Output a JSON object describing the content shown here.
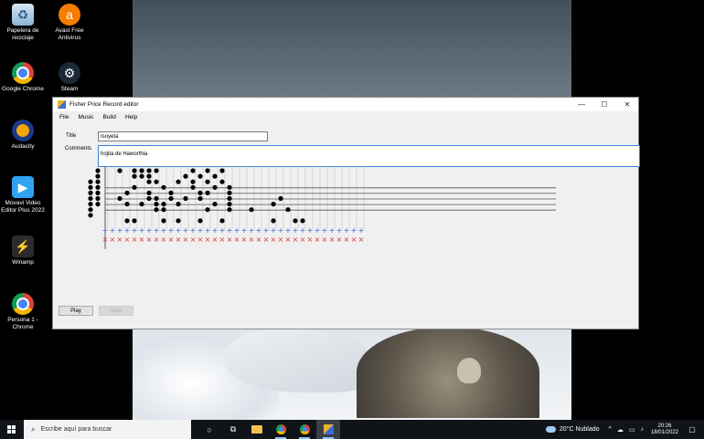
{
  "desktop": {
    "icons": [
      {
        "label": "Papelera de reciclaje",
        "glyph": "♻"
      },
      {
        "label": "Avast Free Antivirus",
        "glyph": "a"
      },
      {
        "label": "Google Chrome",
        "glyph": ""
      },
      {
        "label": "Steam",
        "glyph": "⚙"
      },
      {
        "label": "Audacity",
        "glyph": ""
      },
      {
        "label": "Movavi Video Editor Plus 2022",
        "glyph": "▶"
      },
      {
        "label": "Winamp",
        "glyph": "⚡"
      },
      {
        "label": "Persona 1 - Chrome",
        "glyph": ""
      }
    ]
  },
  "window": {
    "title": "Fisher Price Record editor",
    "controls": {
      "minimize": "—",
      "maximize": "☐",
      "close": "✕"
    },
    "menu": [
      "File",
      "Music",
      "Build",
      "Help"
    ],
    "form": {
      "title_label": "Title",
      "title_value": "Isoyeta",
      "comments_label": "Comments",
      "comments_value": "hojita de Haworthia"
    },
    "music": {
      "rows": 9,
      "columns": 38,
      "plus_symbol": "+",
      "cross_symbol": "×",
      "plus_color": "#3b5bdb",
      "cross_color": "#e03131",
      "notes": [
        [
          0,
          2
        ],
        [
          0,
          3
        ],
        [
          0,
          4
        ],
        [
          0,
          5
        ],
        [
          0,
          6
        ],
        [
          0,
          7
        ],
        [
          0,
          8
        ],
        [
          1,
          0
        ],
        [
          1,
          1
        ],
        [
          1,
          2
        ],
        [
          1,
          3
        ],
        [
          1,
          4
        ],
        [
          1,
          5
        ],
        [
          1,
          6
        ],
        [
          4,
          0
        ],
        [
          4,
          5
        ],
        [
          5,
          4
        ],
        [
          5,
          6
        ],
        [
          5,
          9
        ],
        [
          6,
          0
        ],
        [
          6,
          1
        ],
        [
          6,
          3
        ],
        [
          6,
          9
        ],
        [
          7,
          0
        ],
        [
          7,
          1
        ],
        [
          7,
          6
        ],
        [
          8,
          0
        ],
        [
          8,
          1
        ],
        [
          8,
          2
        ],
        [
          8,
          4
        ],
        [
          8,
          5
        ],
        [
          9,
          0
        ],
        [
          9,
          2
        ],
        [
          9,
          5
        ],
        [
          9,
          6
        ],
        [
          9,
          7
        ],
        [
          10,
          3
        ],
        [
          10,
          6
        ],
        [
          10,
          7
        ],
        [
          10,
          9
        ],
        [
          11,
          4
        ],
        [
          11,
          5
        ],
        [
          12,
          2
        ],
        [
          12,
          6
        ],
        [
          12,
          9
        ],
        [
          13,
          1
        ],
        [
          13,
          5
        ],
        [
          14,
          0
        ],
        [
          14,
          2
        ],
        [
          14,
          3
        ],
        [
          15,
          1
        ],
        [
          15,
          4
        ],
        [
          15,
          5
        ],
        [
          15,
          9
        ],
        [
          16,
          0
        ],
        [
          16,
          2
        ],
        [
          16,
          4
        ],
        [
          16,
          7
        ],
        [
          17,
          1
        ],
        [
          17,
          3
        ],
        [
          17,
          6
        ],
        [
          18,
          0
        ],
        [
          18,
          2
        ],
        [
          18,
          9
        ],
        [
          19,
          3
        ],
        [
          19,
          4
        ],
        [
          19,
          5
        ],
        [
          19,
          6
        ],
        [
          19,
          7
        ],
        [
          22,
          7
        ],
        [
          25,
          6
        ],
        [
          25,
          9
        ],
        [
          26,
          5
        ],
        [
          27,
          7
        ],
        [
          28,
          9
        ],
        [
          29,
          9
        ]
      ]
    },
    "buttons": {
      "play": "Play",
      "stop": "Stop"
    }
  },
  "taskbar": {
    "search_placeholder": "Escribe aquí para buscar",
    "weather": "20°C  Nublado",
    "time": "20:26",
    "date": "18/01/2022"
  }
}
